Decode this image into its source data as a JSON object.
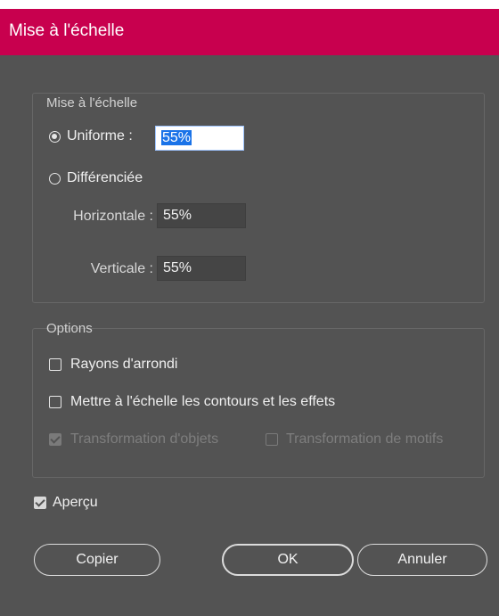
{
  "dialog": {
    "title": "Mise à l'échelle"
  },
  "scale_group": {
    "label": "Mise à l'échelle",
    "uniform": {
      "label": "Uniforme :",
      "checked": true,
      "value": "55%"
    },
    "non_uniform": {
      "label": "Différenciée",
      "checked": false
    },
    "horizontal": {
      "label": "Horizontale :",
      "value": "55%"
    },
    "vertical": {
      "label": "Verticale :",
      "value": "55%"
    }
  },
  "options_group": {
    "label": "Options",
    "rounded_corners": {
      "label": "Rayons d'arrondi",
      "checked": false
    },
    "scale_strokes": {
      "label": "Mettre à l'échelle les contours et les effets",
      "checked": false
    },
    "transform_objects": {
      "label": "Transformation d'objets",
      "checked": true,
      "disabled": true
    },
    "transform_patterns": {
      "label": "Transformation de motifs",
      "checked": false,
      "disabled": true
    }
  },
  "preview": {
    "label": "Aperçu",
    "checked": true
  },
  "buttons": {
    "copy": "Copier",
    "ok": "OK",
    "cancel": "Annuler"
  },
  "colors": {
    "titlebar": "#c8004e",
    "panel": "#535353"
  }
}
